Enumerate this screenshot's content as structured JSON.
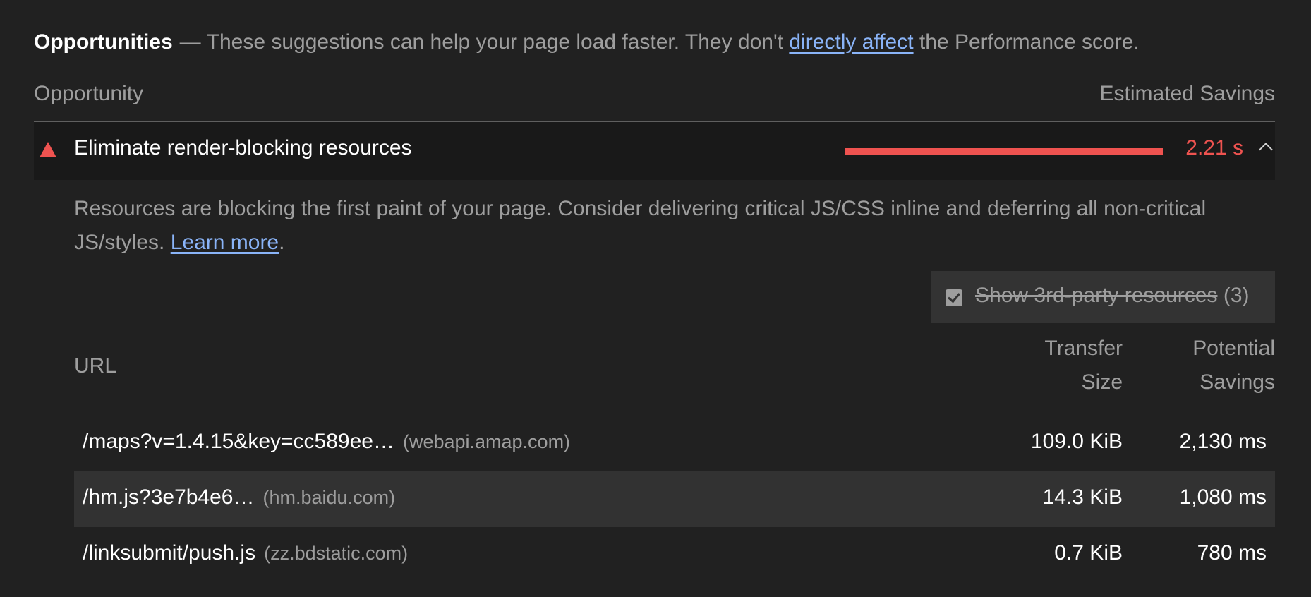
{
  "group": {
    "title": "Opportunities",
    "separator": "—",
    "description_before": "These suggestions can help your page load faster. They don't ",
    "description_link": "directly affect",
    "description_after": " the Performance score."
  },
  "columns": {
    "left": "Opportunity",
    "right": "Estimated Savings"
  },
  "audit": {
    "status_icon": "fail-triangle-icon",
    "title": "Eliminate render-blocking resources",
    "savings_display": "2.21 s",
    "savings_bar_fraction": 1.0,
    "accent_color": "#ef5350",
    "expanded": true,
    "description_text": "Resources are blocking the first paint of your page. Consider delivering critical JS/CSS inline and deferring all non-critical JS/styles. ",
    "learn_more": "Learn more",
    "description_end": "."
  },
  "third_party_filter": {
    "checked": true,
    "label": "Show 3rd-party resources",
    "count": "(3)"
  },
  "table": {
    "headers": {
      "url": "URL",
      "transfer_size_line1": "Transfer",
      "transfer_size_line2": "Size",
      "potential_savings_line1": "Potential",
      "potential_savings_line2": "Savings"
    },
    "rows": [
      {
        "url": "/maps?v=1.4.15&key=cc589ee…",
        "host": "(webapi.amap.com)",
        "size": "109.0 KiB",
        "savings": "2,130 ms"
      },
      {
        "url": "/hm.js?3e7b4e6…",
        "host": "(hm.baidu.com)",
        "size": "14.3 KiB",
        "savings": "1,080 ms"
      },
      {
        "url": "/linksubmit/push.js",
        "host": "(zz.bdstatic.com)",
        "size": "0.7 KiB",
        "savings": "780 ms"
      }
    ]
  }
}
